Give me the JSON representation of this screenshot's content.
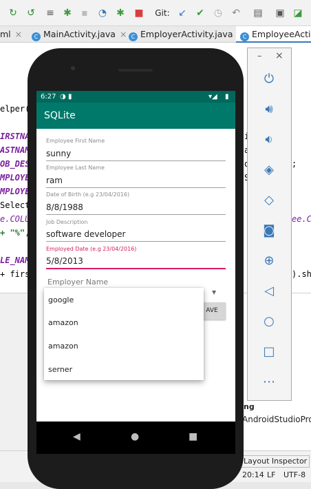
{
  "ide": {
    "toolbar": {
      "git_label": "Git:",
      "icons": [
        "refresh-icon",
        "apply-changes-icon",
        "build-log-icon",
        "debug-icon",
        "gray-device-icon",
        "profiler-icon",
        "attach-debugger-icon",
        "stop-icon",
        "git-update-icon",
        "git-commit-icon",
        "history-icon",
        "undo-icon",
        "project-structure-icon",
        "terminal-icon",
        "avd-icon"
      ]
    },
    "tabs": [
      {
        "label": "ml",
        "partial": true
      },
      {
        "label": "MainActivity.java"
      },
      {
        "label": "EmployerActivity.java"
      },
      {
        "label": "EmployeeActivi",
        "active": true
      }
    ],
    "code_left": [
      "elper(",
      "IRSTNAM",
      "ASTNAM",
      "OB_DESC",
      "MPLOYEE",
      "MPLOYEE",
      "Selecte",
      "e.COLUM",
      "+ \"%\",",
      "LE_NAME",
      "+ first"
    ],
    "code_right": [
      "i",
      "a",
      "o",
      "S",
      "ee.C",
      ").sh"
    ],
    "code_right_extra": [
      ";"
    ],
    "lower_right": {
      "title": "ng",
      "path": "AndroidStudioProje"
    },
    "status": {
      "layout_inspector": "Layout Inspector",
      "position": "20:14",
      "line_sep": "LF",
      "encoding": "UTF-8"
    }
  },
  "side_panel": {
    "window_controls": [
      "minimize-icon",
      "close-icon"
    ],
    "buttons": [
      "power-icon",
      "volume-up-icon",
      "volume-down-icon",
      "rotate-left-icon",
      "rotate-right-icon",
      "camera-icon",
      "zoom-icon",
      "back-icon",
      "home-icon",
      "overview-icon",
      "more-icon"
    ]
  },
  "phone": {
    "status": {
      "time": "6:27"
    },
    "app_title": "SQLite",
    "fields": [
      {
        "label": "Employee First Name",
        "value": "sunny"
      },
      {
        "label": "Employee Last Name",
        "value": "ram"
      },
      {
        "label": "Date of Birth (e.g 23/04/2016)",
        "value": "8/8/1988"
      },
      {
        "label": "Job Description",
        "value": "software developer"
      },
      {
        "label": "Employed Date (e.g 23/04/2016)",
        "value": "5/8/2013",
        "focused": true
      }
    ],
    "employer_label": "Employer Name",
    "save_button": "AVE",
    "dropdown_options": [
      "google",
      "amazon",
      "amazon",
      "serner"
    ],
    "colors": {
      "primary": "#00796b",
      "primary_dark": "#00695c",
      "accent": "#d81b60"
    }
  }
}
